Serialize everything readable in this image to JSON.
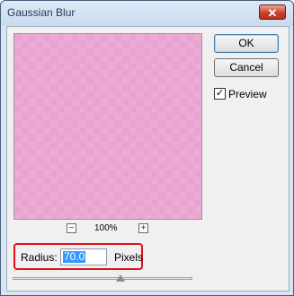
{
  "window": {
    "title": "Gaussian Blur",
    "close_icon": "close-icon"
  },
  "buttons": {
    "ok_label": "OK",
    "cancel_label": "Cancel"
  },
  "preview_option": {
    "label": "Preview",
    "checked": true
  },
  "zoom": {
    "minus": "−",
    "plus": "+",
    "level": "100%"
  },
  "radius": {
    "label": "Radius:",
    "value": "70.0",
    "units": "Pixels"
  },
  "slider": {
    "value_fraction": 0.6
  },
  "colors": {
    "preview": "#eaa3d0",
    "highlight": "#e0101a"
  }
}
